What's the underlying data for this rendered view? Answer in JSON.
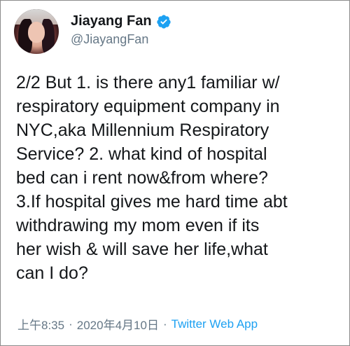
{
  "tweet": {
    "author": {
      "name": "Jiayang Fan",
      "handle": "@JiayangFan",
      "verified": true,
      "avatar_icon": "profile-avatar"
    },
    "text": "2/2 But 1. is there any1 familiar w/\nrespiratory equipment company in\nNYC,aka Millennium Respiratory\nService? 2. what kind of hospital\nbed can i rent now&from where?\n3.If hospital gives me hard time abt\nwithdrawing my mom even if its\nher wish & will save her life,what\ncan I do?",
    "time": "上午8:35",
    "separator": "·",
    "date": "2020年4月10日",
    "source": "Twitter Web App"
  },
  "colors": {
    "text": "#14171a",
    "secondary": "#657786",
    "link": "#1da1f2",
    "verified_badge": "#1da1f2"
  }
}
